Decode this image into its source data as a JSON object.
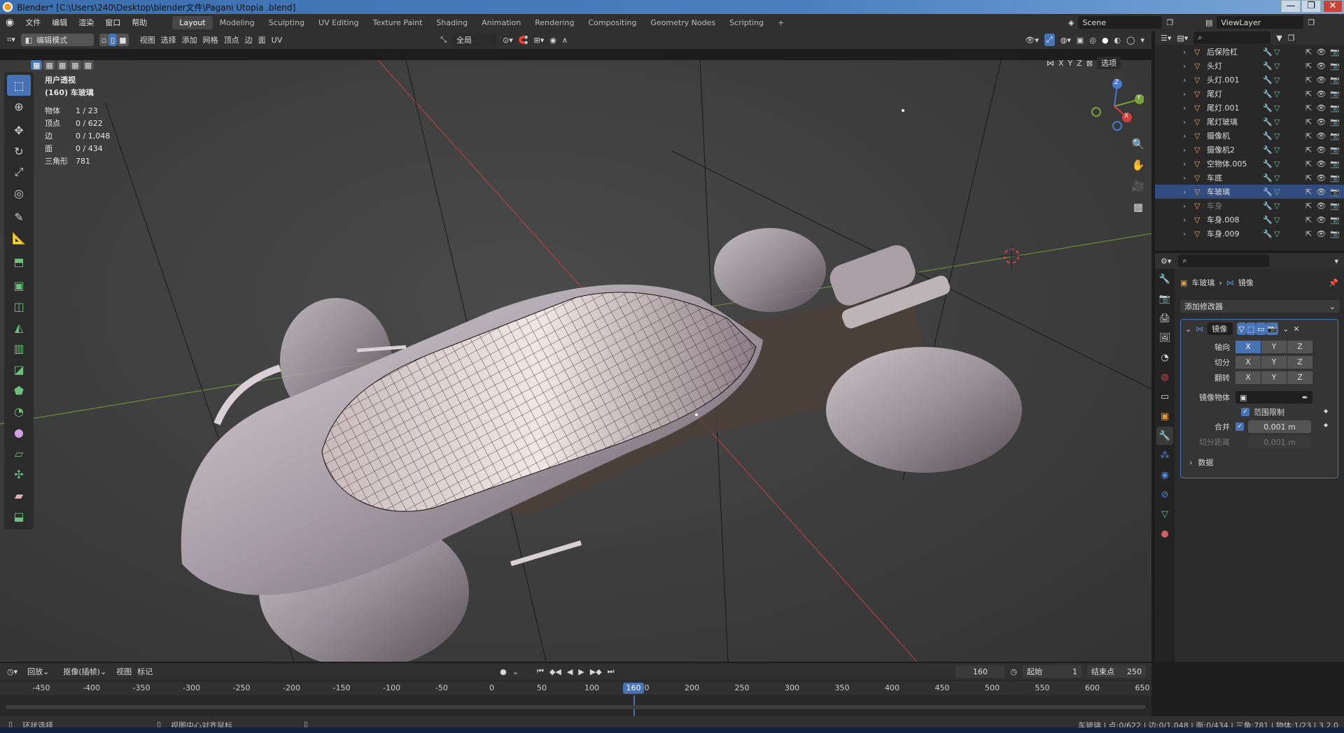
{
  "window": {
    "title": "Blender* [C:\\Users\\240\\Desktop\\blender文件\\Pagani Utopia .blend]",
    "minimize": "—",
    "maximize": "❐",
    "close": "✕"
  },
  "menu": {
    "items": [
      "文件",
      "编辑",
      "渲染",
      "窗口",
      "帮助"
    ],
    "workspaces": [
      "Layout",
      "Modeling",
      "Sculpting",
      "UV Editing",
      "Texture Paint",
      "Shading",
      "Animation",
      "Rendering",
      "Compositing",
      "Geometry Nodes",
      "Scripting"
    ],
    "add_workspace": "+",
    "scene": "Scene",
    "view_layer": "ViewLayer"
  },
  "viewport_header": {
    "mode": "编辑模式",
    "menus": [
      "视图",
      "选择",
      "添加",
      "网格",
      "顶点",
      "边",
      "面",
      "UV"
    ],
    "transform_orientation": "全局",
    "options": "选项",
    "axes": [
      "X",
      "Y",
      "Z"
    ]
  },
  "overlay": {
    "view_name": "用户透视",
    "object_name": "(160) 车玻璃",
    "stats": [
      {
        "label": "物体",
        "value": "1 / 23"
      },
      {
        "label": "顶点",
        "value": "0 / 622"
      },
      {
        "label": "边",
        "value": "0 / 1,048"
      },
      {
        "label": "面",
        "value": "0 / 434"
      },
      {
        "label": "三角形",
        "value": "781"
      }
    ]
  },
  "gizmo": {
    "x": "X",
    "y": "Y",
    "z": "Z"
  },
  "outliner": {
    "items": [
      {
        "name": "后保险杠",
        "selected": false,
        "dim": false
      },
      {
        "name": "头灯",
        "selected": false,
        "dim": false
      },
      {
        "name": "头灯.001",
        "selected": false,
        "dim": false
      },
      {
        "name": "尾灯",
        "selected": false,
        "dim": false
      },
      {
        "name": "尾灯.001",
        "selected": false,
        "dim": false
      },
      {
        "name": "尾灯玻璃",
        "selected": false,
        "dim": false
      },
      {
        "name": "摄像机",
        "selected": false,
        "dim": false
      },
      {
        "name": "摄像机2",
        "selected": false,
        "dim": false
      },
      {
        "name": "空物体.005",
        "selected": false,
        "dim": false
      },
      {
        "name": "车底",
        "selected": false,
        "dim": false
      },
      {
        "name": "车玻璃",
        "selected": true,
        "dim": false
      },
      {
        "name": "车身",
        "selected": false,
        "dim": true
      },
      {
        "name": "车身.008",
        "selected": false,
        "dim": false
      },
      {
        "name": "车身.009",
        "selected": false,
        "dim": false
      }
    ]
  },
  "properties": {
    "breadcrumb_object": "车玻璃",
    "breadcrumb_modifier": "镜像",
    "add_modifier": "添加修改器",
    "modifier_name": "镜像",
    "axis_label": "轴向",
    "bisect_label": "切分",
    "flip_label": "翻转",
    "mirror_object_label": "镜像物体",
    "clipping_label": "范围限制",
    "merge_label": "合并",
    "merge_value": "0.001 m",
    "bisect_distance_label": "切分距离",
    "bisect_distance_value": "0.001 m",
    "data_label": "数据",
    "axes": [
      "X",
      "Y",
      "Z"
    ]
  },
  "timeline": {
    "playback": "回放",
    "keying": "抠像(插帧)",
    "view": "视图",
    "marker": "标记",
    "current_frame": "160",
    "start_label": "起始",
    "start_value": "1",
    "end_label": "结束点",
    "end_value": "250",
    "ruler_ticks": [
      "-450",
      "-400",
      "-350",
      "-300",
      "-250",
      "-200",
      "-150",
      "-100",
      "-50",
      "0",
      "50",
      "100",
      "150",
      "200",
      "250",
      "300",
      "350",
      "400",
      "450",
      "500",
      "550",
      "600",
      "650"
    ],
    "frame_badge": "160"
  },
  "status": {
    "left1": "环状选择",
    "left2": "视图中心对齐鼠标",
    "right": "车玻璃 | 点:0/622 | 边:0/1,048 | 面:0/434 | 三角:781 | 物体:1/23 | 3.2.0"
  }
}
